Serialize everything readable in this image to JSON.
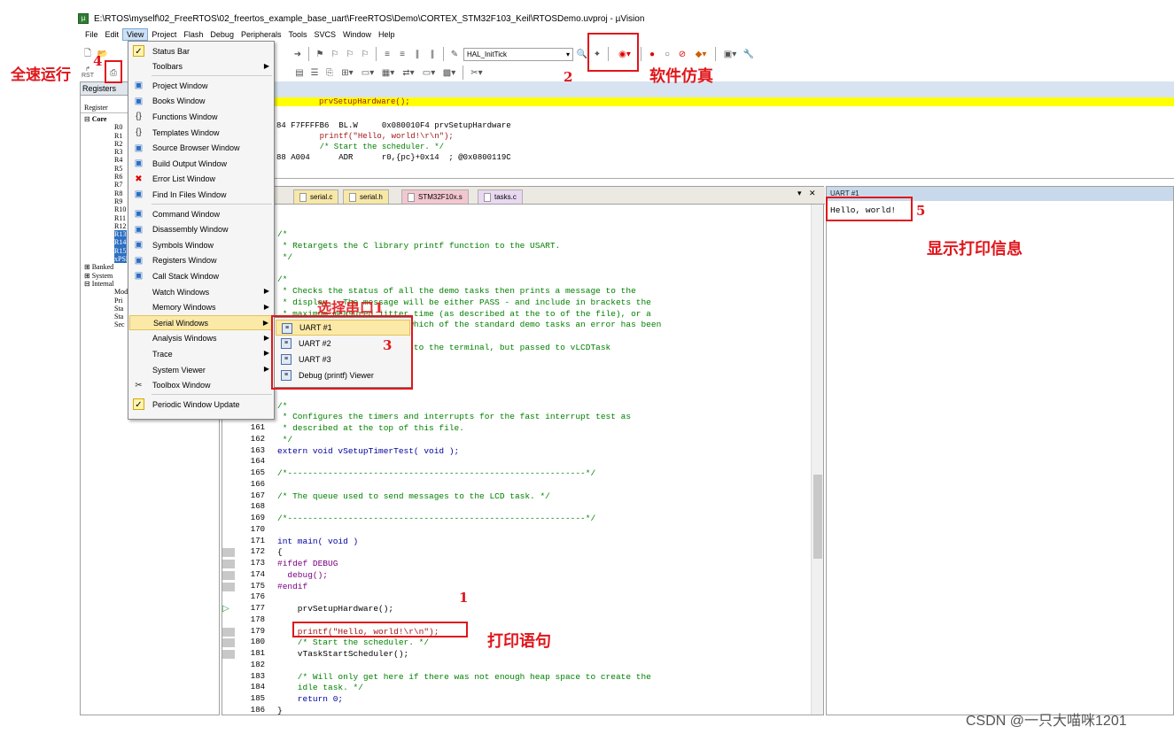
{
  "window": {
    "title": "E:\\RTOS\\myself\\02_FreeRTOS\\02_freertos_example_base_uart\\FreeRTOS\\Demo\\CORTEX_STM32F103_Keil\\RTOSDemo.uvproj - µVision"
  },
  "menubar": [
    "File",
    "Edit",
    "View",
    "Project",
    "Flash",
    "Debug",
    "Peripherals",
    "Tools",
    "SVCS",
    "Window",
    "Help"
  ],
  "toolbar": {
    "combo_function": "HAL_InitTick",
    "rst_label": "RST"
  },
  "registers": {
    "panel_title": "Registers",
    "column_header": "Register",
    "group_core": "Core",
    "items": [
      "R0",
      "R1",
      "R2",
      "R3",
      "R4",
      "R5",
      "R6",
      "R7",
      "R8",
      "R9",
      "R10",
      "R11",
      "R12",
      "R13",
      "R14",
      "R15",
      "xPSR"
    ],
    "other_groups": [
      "Banked",
      "System",
      "Internal"
    ],
    "internal_items": [
      "Mod",
      "Pri",
      "Sta",
      "Sta",
      "Sec"
    ]
  },
  "disassembly": {
    "highlighted": "prvSetupHardware();",
    "lines": [
      "84 F7FFFFB6  BL.W     0x080010F4 prvSetupHardware",
      "         printf(\"Hello, world!\\r\\n\");",
      "         /* Start the scheduler. */",
      "88 A004      ADR      r0,{pc}+0x14  ; @0x0800119C"
    ]
  },
  "editor_tabs": [
    "serial.c",
    "serial.h",
    "STM32F10x.s",
    "tasks.c"
  ],
  "code_top": [
    {
      "t": "/*",
      "c": "cm"
    },
    {
      "t": " * Retargets the C library printf function to the USART.",
      "c": "cm"
    },
    {
      "t": " */",
      "c": "cm"
    },
    {
      "t": "",
      "c": ""
    },
    {
      "t": "/*",
      "c": "cm"
    },
    {
      "t": " * Checks the status of all the demo tasks then prints a message to the",
      "c": "cm"
    },
    {
      "t": " * display.  The message will be either PASS - and include in brackets the",
      "c": "cm"
    },
    {
      "t": " * maximum measured jitter time (as described at the to of the file), or a",
      "c": "cm"
    },
    {
      "t": " * message that describes which of the standard demo tasks an error has been",
      "c": "cm"
    },
    {
      "t": "",
      "c": ""
    },
    {
      "t": " * is not written directly to the terminal, but passed to vLCDTask",
      "c": "cm"
    }
  ],
  "code_lines": [
    {
      "n": "",
      "t": "/*",
      "c": "cm"
    },
    {
      "n": "",
      "t": " * Configures the timers and interrupts for the fast interrupt test as",
      "c": "cm"
    },
    {
      "n": "161",
      "t": " * described at the top of this file.",
      "c": "cm"
    },
    {
      "n": "162",
      "t": " */",
      "c": "cm"
    },
    {
      "n": "163",
      "t": "extern void vSetupTimerTest( void );",
      "c": ""
    },
    {
      "n": "164",
      "t": "",
      "c": ""
    },
    {
      "n": "165",
      "t": "/*-----------------------------------------------------------*/",
      "c": "cm"
    },
    {
      "n": "166",
      "t": "",
      "c": ""
    },
    {
      "n": "167",
      "t": "/* The queue used to send messages to the LCD task. */",
      "c": "cm"
    },
    {
      "n": "168",
      "t": "",
      "c": ""
    },
    {
      "n": "169",
      "t": "/*-----------------------------------------------------------*/",
      "c": "cm"
    },
    {
      "n": "170",
      "t": "",
      "c": ""
    },
    {
      "n": "171",
      "t": "int main( void )",
      "c": ""
    },
    {
      "n": "172",
      "t": "{",
      "c": ""
    },
    {
      "n": "173",
      "t": "#ifdef DEBUG",
      "c": ""
    },
    {
      "n": "174",
      "t": "  debug();",
      "c": ""
    },
    {
      "n": "175",
      "t": "#endif",
      "c": ""
    },
    {
      "n": "176",
      "t": "",
      "c": ""
    },
    {
      "n": "177",
      "t": "    prvSetupHardware();",
      "c": ""
    },
    {
      "n": "178",
      "t": "",
      "c": ""
    },
    {
      "n": "179",
      "t": "    printf(\"Hello, world!\\r\\n\");",
      "c": ""
    },
    {
      "n": "180",
      "t": "    /* Start the scheduler. */",
      "c": "cm"
    },
    {
      "n": "181",
      "t": "    vTaskStartScheduler();",
      "c": ""
    },
    {
      "n": "182",
      "t": "",
      "c": ""
    },
    {
      "n": "183",
      "t": "    /* Will only get here if there was not enough heap space to create the",
      "c": "cm"
    },
    {
      "n": "184",
      "t": "    idle task. */",
      "c": "cm"
    },
    {
      "n": "185",
      "t": "    return 0;",
      "c": ""
    },
    {
      "n": "186",
      "t": "}",
      "c": ""
    }
  ],
  "view_menu": [
    {
      "label": "Status Bar",
      "icon": "check-icon",
      "arrow": false
    },
    {
      "label": "Toolbars",
      "icon": "",
      "arrow": true
    },
    {
      "label": "Project Window",
      "icon": "project-window-icon",
      "arrow": false
    },
    {
      "label": "Books Window",
      "icon": "books-icon",
      "arrow": false
    },
    {
      "label": "Functions Window",
      "icon": "functions-icon",
      "arrow": false
    },
    {
      "label": "Templates Window",
      "icon": "templates-icon",
      "arrow": false
    },
    {
      "label": "Source Browser Window",
      "icon": "source-browser-icon",
      "arrow": false
    },
    {
      "label": "Build Output Window",
      "icon": "build-output-icon",
      "arrow": false
    },
    {
      "label": "Error List Window",
      "icon": "error-list-icon",
      "arrow": false
    },
    {
      "label": "Find In Files Window",
      "icon": "find-in-files-icon",
      "arrow": false
    },
    {
      "label": "Command Window",
      "icon": "command-window-icon",
      "arrow": false
    },
    {
      "label": "Disassembly Window",
      "icon": "disassembly-icon",
      "arrow": false
    },
    {
      "label": "Symbols Window",
      "icon": "symbols-icon",
      "arrow": false
    },
    {
      "label": "Registers Window",
      "icon": "registers-icon",
      "arrow": false
    },
    {
      "label": "Call Stack Window",
      "icon": "call-stack-icon",
      "arrow": false
    },
    {
      "label": "Watch Windows",
      "icon": "",
      "arrow": true
    },
    {
      "label": "Memory Windows",
      "icon": "",
      "arrow": true
    },
    {
      "label": "Serial Windows",
      "icon": "",
      "arrow": true
    },
    {
      "label": "Analysis Windows",
      "icon": "",
      "arrow": true
    },
    {
      "label": "Trace",
      "icon": "",
      "arrow": true
    },
    {
      "label": "System Viewer",
      "icon": "",
      "arrow": true
    },
    {
      "label": "Toolbox Window",
      "icon": "toolbox-icon",
      "arrow": false
    },
    {
      "label": "Periodic Window Update",
      "icon": "check-icon",
      "arrow": false
    }
  ],
  "serial_submenu": [
    "UART #1",
    "UART #2",
    "UART #3",
    "Debug (printf) Viewer"
  ],
  "uart_panel": {
    "title": "UART #1",
    "output": "Hello, world!"
  },
  "annotations": {
    "full_speed_run": "全速运行",
    "software_sim": "软件仿真",
    "select": "选择串口1",
    "show_print": "显示打印信息",
    "print_stmt": "打印语句",
    "n1": "1",
    "n2": "2",
    "n3": "3",
    "n4": "4",
    "n5": "5"
  },
  "watermark": "CSDN @一只大喵咪1201",
  "colors": {
    "annotation_red": "#e0161b",
    "highlight_yellow": "#ffff00",
    "menu_highlight": "#fbe9a8"
  }
}
